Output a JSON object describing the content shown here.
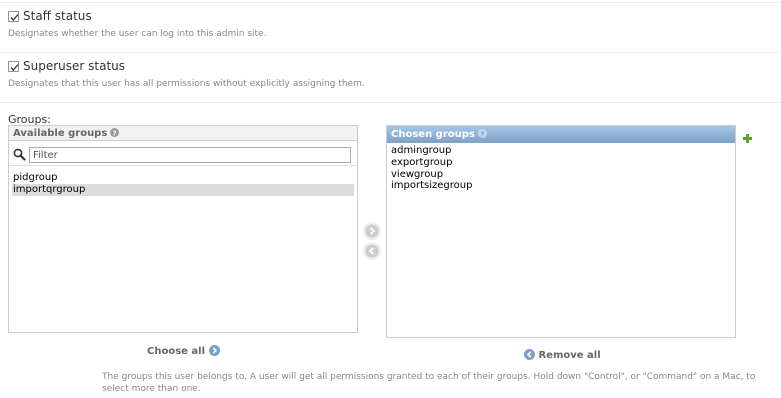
{
  "staff": {
    "label": "Staff status",
    "checked": true,
    "help": "Designates whether the user can log into this admin site."
  },
  "superuser": {
    "label": "Superuser status",
    "checked": true,
    "help": "Designates that this user has all permissions without explicitly assigning them."
  },
  "groups": {
    "label": "Groups:",
    "available": {
      "title": "Available groups",
      "filter_placeholder": "Filter",
      "items": [
        "pidgroup",
        "importqrgroup"
      ],
      "selected_index": 1
    },
    "chosen": {
      "title": "Chosen groups",
      "items": [
        "admingroup",
        "exportgroup",
        "viewgroup",
        "importsizegroup"
      ]
    },
    "choose_all_label": "Choose all",
    "remove_all_label": "Remove all",
    "help": "The groups this user belongs to. A user will get all permissions granted to each of their groups. Hold down \"Control\", or \"Command\" on a Mac, to select more than one."
  },
  "icons": {
    "checkbox": "check-icon",
    "help": "question-icon",
    "search": "search-icon",
    "add_arrow": "arrow-right-icon",
    "remove_arrow": "arrow-left-icon",
    "add_related": "plus-icon"
  },
  "colors": {
    "chosen_header": "#7ca0c7",
    "add_icon": "#5fa225",
    "arrow_icon": "#7ca0c7"
  }
}
